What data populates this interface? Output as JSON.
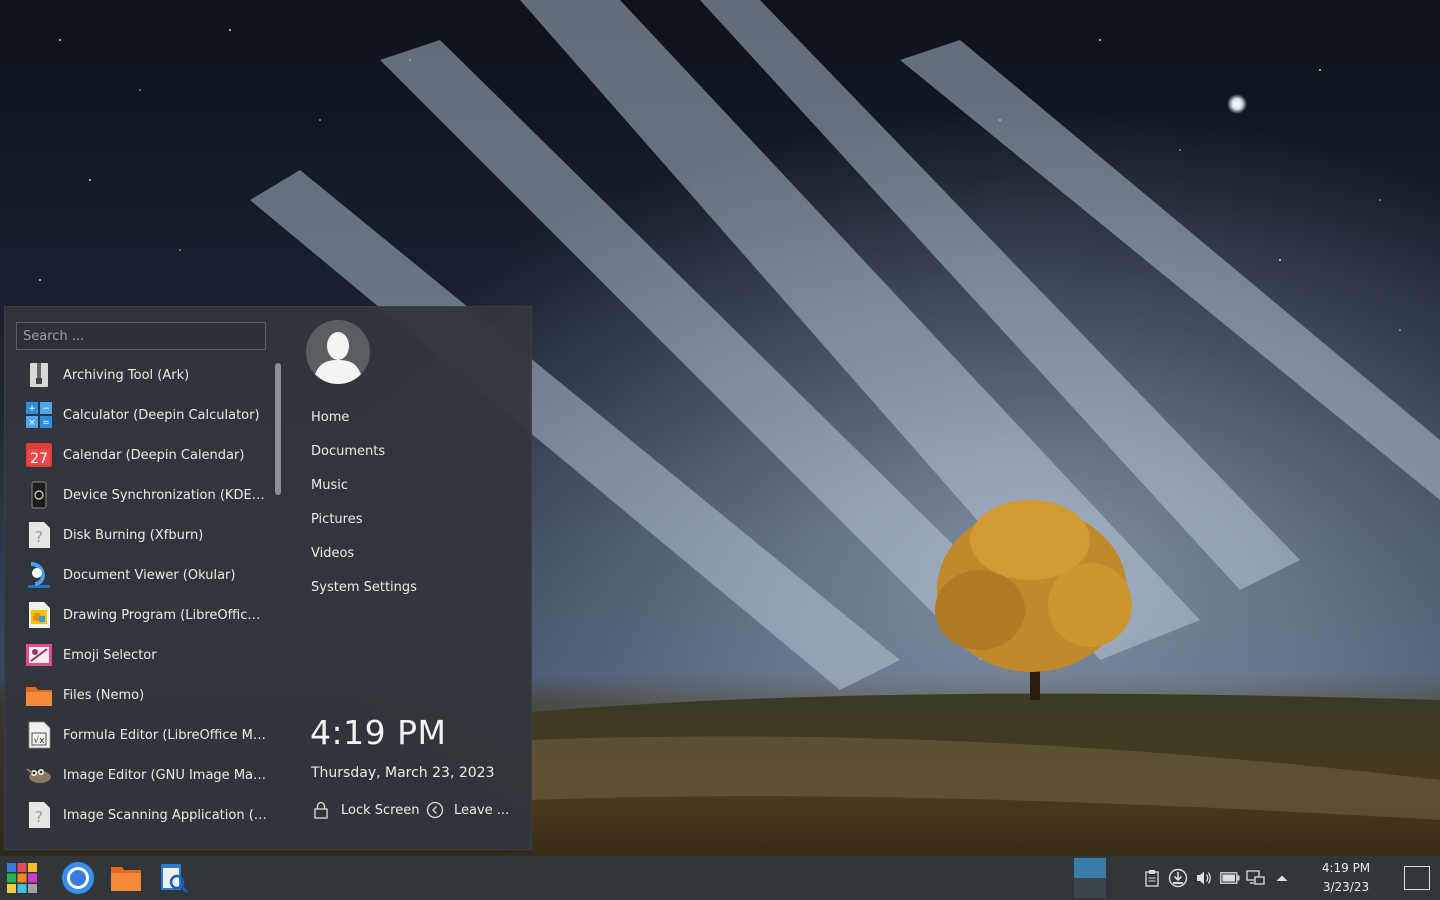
{
  "menu": {
    "search_placeholder": "Search ...",
    "apps": [
      {
        "label": "Archiving Tool (Ark)",
        "icon": "archive-icon"
      },
      {
        "label": "Calculator (Deepin Calculator)",
        "icon": "calculator-icon"
      },
      {
        "label": "Calendar (Deepin Calendar)",
        "icon": "calendar-icon",
        "icon_text": "27"
      },
      {
        "label": "Device Synchronization (KDE C...",
        "icon": "phone-sync-icon"
      },
      {
        "label": "Disk Burning (Xfburn)",
        "icon": "unknown-app-icon",
        "icon_text": "?"
      },
      {
        "label": "Document Viewer (Okular)",
        "icon": "okular-icon"
      },
      {
        "label": "Drawing Program (LibreOffice ...",
        "icon": "draw-icon"
      },
      {
        "label": "Emoji Selector",
        "icon": "emoji-icon"
      },
      {
        "label": "Files (Nemo)",
        "icon": "folder-icon"
      },
      {
        "label": "Formula Editor (LibreOffice Mat...",
        "icon": "math-icon",
        "icon_text": "√x"
      },
      {
        "label": "Image Editor (GNU Image Mani...",
        "icon": "gimp-icon"
      },
      {
        "label": "Image Scanning Application (Sk...",
        "icon": "unknown-app-icon",
        "icon_text": "?"
      }
    ],
    "places": [
      "Home",
      "Documents",
      "Music",
      "Pictures",
      "Videos",
      "System Settings"
    ],
    "clock_time": "4:19 PM",
    "clock_date": "Thursday, March 23, 2023",
    "lock_label": "Lock Screen",
    "leave_label": "Leave ..."
  },
  "taskbar": {
    "time": "4:19 PM",
    "date": "3/23/23",
    "launchers": [
      "app-menu-icon",
      "chromium-icon",
      "file-manager-icon",
      "search-app-icon"
    ],
    "tray": [
      "clipboard-icon",
      "update-icon",
      "volume-icon",
      "battery-icon",
      "network-icon",
      "tray-expand-icon"
    ]
  },
  "colors": {
    "menu_bg": "#32363c",
    "taskbar_bg": "#31363b",
    "active_desktop": "#3a7ca8"
  }
}
